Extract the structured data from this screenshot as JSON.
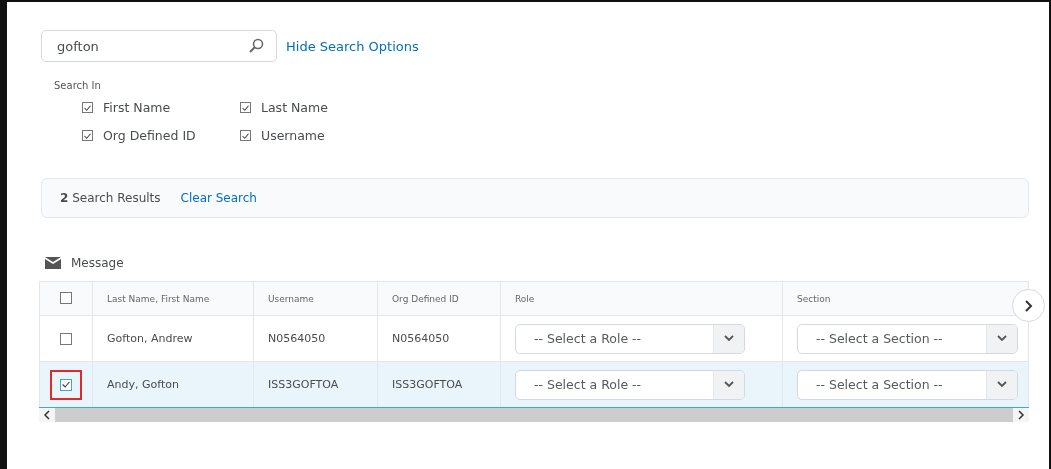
{
  "search": {
    "value": "gofton",
    "toggle_link": "Hide Search Options"
  },
  "search_in": {
    "label": "Search In",
    "options": [
      {
        "label": "First Name",
        "checked": true
      },
      {
        "label": "Last Name",
        "checked": true
      },
      {
        "label": "Org Defined ID",
        "checked": true
      },
      {
        "label": "Username",
        "checked": true
      }
    ]
  },
  "results": {
    "count": "2",
    "label": "Search Results",
    "clear_link": "Clear Search"
  },
  "message_button": "Message",
  "table": {
    "select_all_checked": false,
    "columns": [
      "Last Name, First Name",
      "Username",
      "Org Defined ID",
      "Role",
      "Section"
    ],
    "rows": [
      {
        "name": "Gofton, Andrew",
        "username": "N0564050",
        "org_id": "N0564050",
        "role": "-- Select a Role --",
        "section": "-- Select a Section --",
        "selected": false
      },
      {
        "name": "Andy, Gofton",
        "username": "ISS3GOFTOA",
        "org_id": "ISS3GOFTOA",
        "role": "-- Select a Role --",
        "section": "-- Select a Section --",
        "selected": true
      }
    ]
  }
}
